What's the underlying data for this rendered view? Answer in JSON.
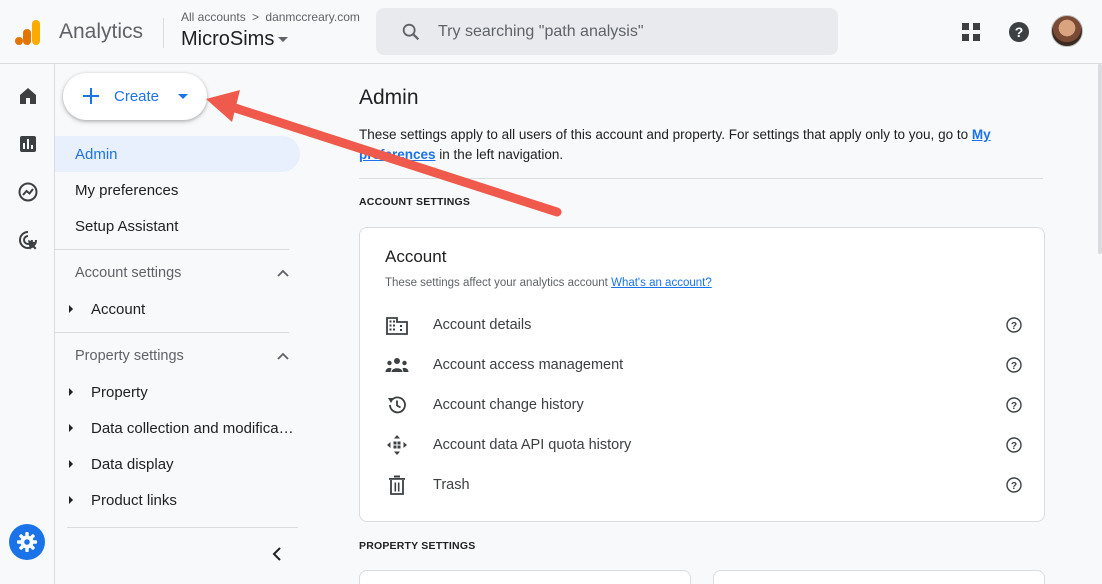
{
  "header": {
    "app_name": "Analytics",
    "breadcrumb_root": "All accounts",
    "breadcrumb_sep": ">",
    "breadcrumb_account": "danmccreary.com",
    "property_name": "MicroSims",
    "search_placeholder": "Try searching \"path analysis\""
  },
  "sidebar": {
    "create_label": "Create",
    "nav": [
      "Admin",
      "My preferences",
      "Setup Assistant"
    ],
    "account_settings_label": "Account settings",
    "account_items": [
      "Account"
    ],
    "property_settings_label": "Property settings",
    "property_items": [
      "Property",
      "Data collection and modifica…",
      "Data display",
      "Product links"
    ]
  },
  "main": {
    "title": "Admin",
    "desc_prefix": "These settings apply to all users of this account and property. For settings that apply only to you, go to ",
    "desc_link": "My preferences",
    "desc_suffix": " in the left navigation.",
    "account_settings_heading": "ACCOUNT SETTINGS",
    "property_settings_heading": "PROPERTY SETTINGS",
    "account_card": {
      "title": "Account",
      "subtitle": "These settings affect your analytics account",
      "subtitle_link": "What's an account?",
      "rows": [
        {
          "label": "Account details",
          "icon": "building-icon"
        },
        {
          "label": "Account access management",
          "icon": "people-icon"
        },
        {
          "label": "Account change history",
          "icon": "history-icon"
        },
        {
          "label": "Account data API quota history",
          "icon": "api-quota-icon"
        },
        {
          "label": "Trash",
          "icon": "trash-icon"
        }
      ]
    }
  },
  "colors": {
    "accent": "#1a73e8",
    "annotation_arrow": "#ef5a4c",
    "logo_orange": "#f9ab00",
    "logo_dark_orange": "#e37400"
  }
}
